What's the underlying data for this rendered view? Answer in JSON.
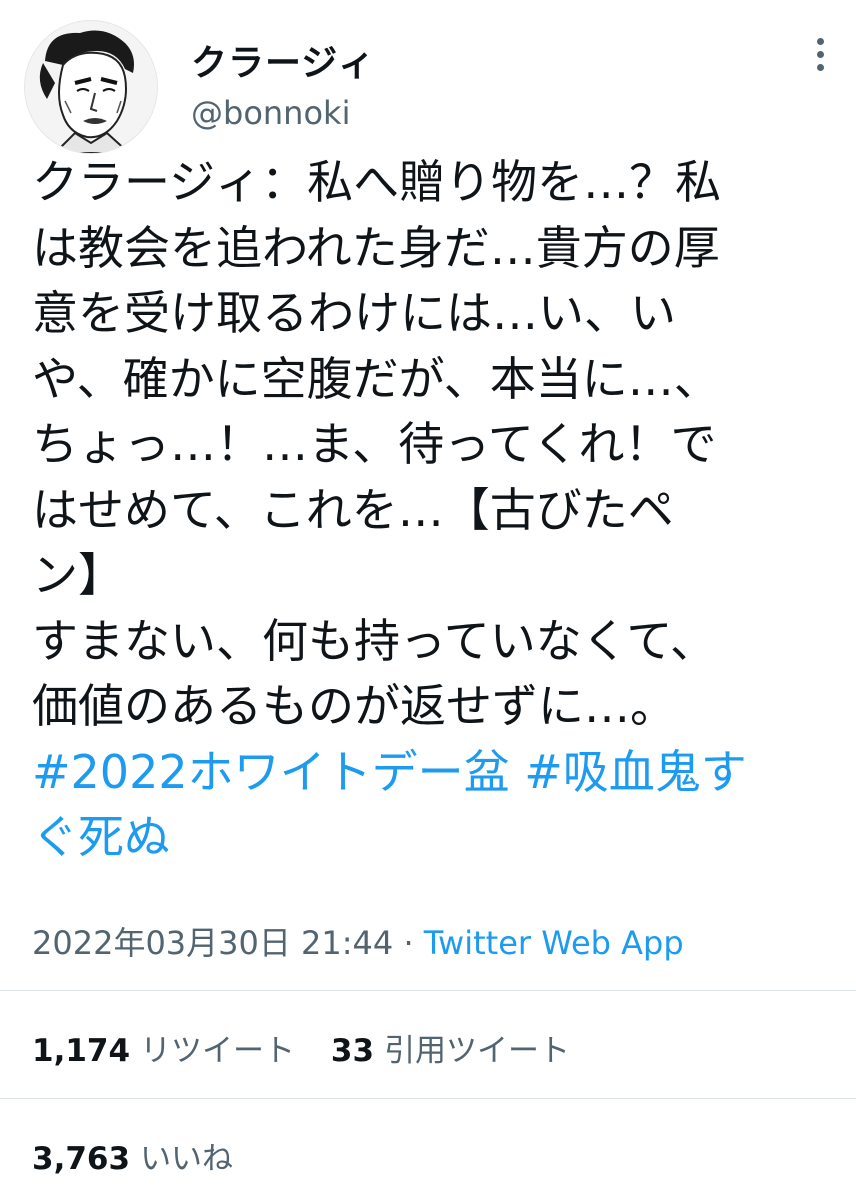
{
  "user": {
    "display_name": "クラージィ",
    "handle": "@bonnoki",
    "avatar_icon": "avatar-manga-portrait"
  },
  "tweet": {
    "lines": [
      "クラージィ：私へ贈り物を…？私",
      "は教会を追われた身だ…貴方の厚",
      "意を受け取るわけには…い、い",
      "や、確かに空腹だが、本当に…、",
      "ちょっ…！…ま、待ってくれ！で",
      "はせめて、これを…【古びたペ",
      "ン】",
      "すまない、何も持っていなくて、",
      "価値のあるものが返せずに…。"
    ],
    "hashtag_line_1a": "#2022ホワイトデー盆",
    "hashtag_line_1b": "#吸血鬼す",
    "hashtag_line_2": "ぐ死ぬ"
  },
  "meta": {
    "timestamp": "2022年03月30日 21:44",
    "separator": " · ",
    "source": "Twitter Web App"
  },
  "stats": {
    "retweets_count": "1,174",
    "retweets_label": "リツイート",
    "quotes_count": "33",
    "quotes_label": "引用ツイート",
    "likes_count": "3,763",
    "likes_label": "いいね"
  },
  "colors": {
    "link": "#1d9bf0",
    "secondary_text": "#536471",
    "primary_text": "#0f1419"
  }
}
